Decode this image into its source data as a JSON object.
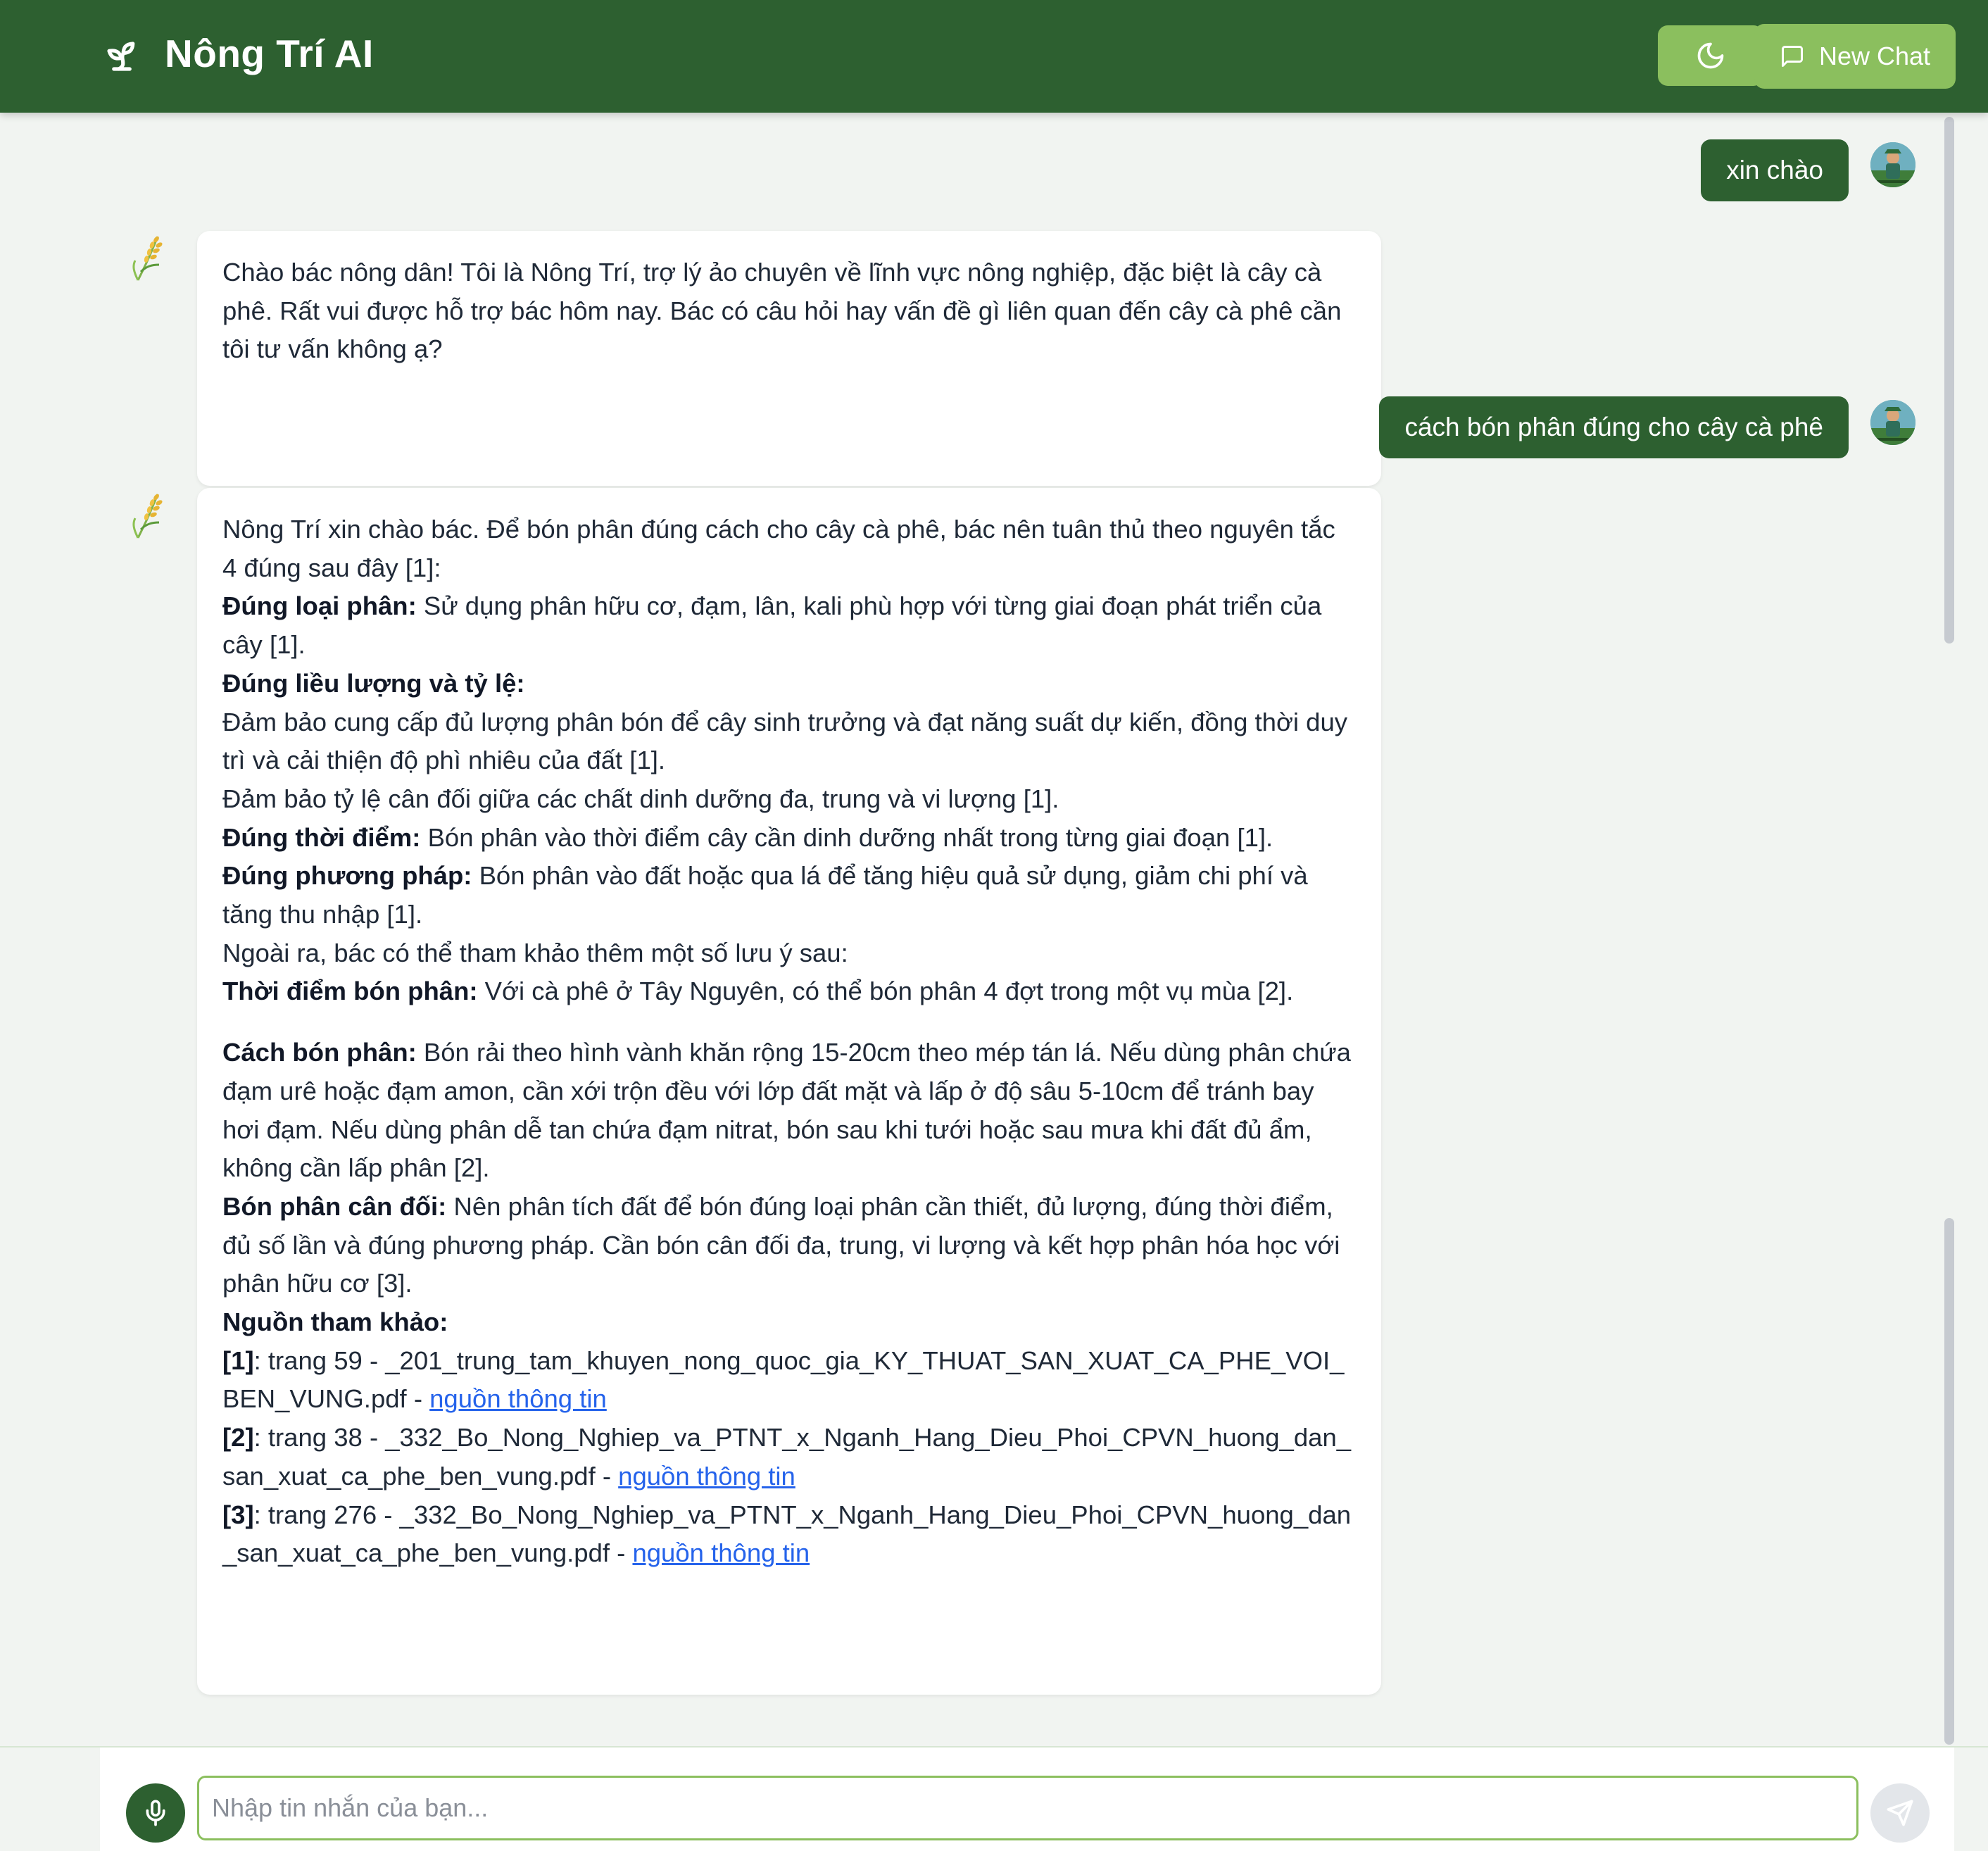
{
  "header": {
    "title": "Nông Trí AI",
    "brand_icon": "sprout-icon",
    "theme_toggle_icon": "moon-icon",
    "new_chat_label": "New Chat",
    "new_chat_icon": "message-square-icon",
    "colors": {
      "header_bg": "#2d6030",
      "button_bg": "#8bbf5e"
    }
  },
  "messages": {
    "user_1": "xin chào",
    "bot_1": "Chào bác nông dân! Tôi là Nông Trí, trợ lý ảo chuyên về lĩnh vực nông nghiệp, đặc biệt là cây cà phê. Rất vui được hỗ trợ bác hôm nay. Bác có câu hỏi hay vấn đề gì liên quan đến cây cà phê cần tôi tư vấn không ạ?",
    "user_2": "cách bón phân đúng cho cây cà phê",
    "bot_2": {
      "intro": "Nông Trí xin chào bác. Để bón phân đúng cách cho cây cà phê, bác nên tuân thủ theo nguyên tắc 4 đúng sau đây [1]:",
      "p1_label": "Đúng loại phân:",
      "p1_text": " Sử dụng phân hữu cơ, đạm, lân, kali phù hợp với từng giai đoạn phát triển của cây [1].",
      "p2_label": "Đúng liều lượng và tỷ lệ:",
      "p2_a": "Đảm bảo cung cấp đủ lượng phân bón để cây sinh trưởng và đạt năng suất dự kiến, đồng thời duy trì và cải thiện độ phì nhiêu của đất [1].",
      "p2_b": "Đảm bảo tỷ lệ cân đối giữa các chất dinh dưỡng đa, trung và vi lượng [1].",
      "p3_label": "Đúng thời điểm:",
      "p3_text": " Bón phân vào thời điểm cây cần dinh dưỡng nhất trong từng giai đoạn [1].",
      "p4_label": "Đúng phương pháp:",
      "p4_text": " Bón phân vào đất hoặc qua lá để tăng hiệu quả sử dụng, giảm chi phí và tăng thu nhập [1].",
      "extra_intro": "Ngoài ra, bác có thể tham khảo thêm một số lưu ý sau:",
      "n1_label": "Thời điểm bón phân:",
      "n1_text": " Với cà phê ở Tây Nguyên, có thể bón phân 4 đợt trong một vụ mùa [2].",
      "n2_label": "Cách bón phân:",
      "n2_text": " Bón rải theo hình vành khăn rộng 15-20cm theo mép tán lá. Nếu dùng phân chứa đạm urê hoặc đạm amon, cần xới trộn đều với lớp đất mặt và lấp ở độ sâu 5-10cm để tránh bay hơi đạm. Nếu dùng phân dễ tan chứa đạm nitrat, bón sau khi tưới hoặc sau mưa khi đất đủ ẩm, không cần lấp phân [2].",
      "n3_label": "Bón phân cân đối:",
      "n3_text": " Nên phân tích đất để bón đúng loại phân cần thiết, đủ lượng, đúng thời điểm, đủ số lần và đúng phương pháp. Cần bón cân đối đa, trung, vi lượng và kết hợp phân hóa học với phân hữu cơ [3].",
      "sources_label": "Nguồn tham khảo:",
      "sources": [
        {
          "tag": "[1]",
          "text": ": trang 59 - _201_trung_tam_khuyen_nong_quoc_gia_KY_THUAT_SAN_XUAT_CA_PHE_VOI_BEN_VUNG.pdf - ",
          "link": "nguồn thông tin"
        },
        {
          "tag": "[2]",
          "text": ": trang 38 - _332_Bo_Nong_Nghiep_va_PTNT_x_Nganh_Hang_Dieu_Phoi_CPVN_huong_dan_san_xuat_ca_phe_ben_vung.pdf - ",
          "link": "nguồn thông tin"
        },
        {
          "tag": "[3]",
          "text": ": trang 276 - _332_Bo_Nong_Nghiep_va_PTNT_x_Nganh_Hang_Dieu_Phoi_CPVN_huong_dan_san_xuat_ca_phe_ben_vung.pdf - ",
          "link": "nguồn thông tin"
        }
      ]
    }
  },
  "input": {
    "placeholder": "Nhập tin nhắn của bạn...",
    "value": "",
    "mic_icon": "microphone-icon",
    "send_icon": "send-icon"
  }
}
